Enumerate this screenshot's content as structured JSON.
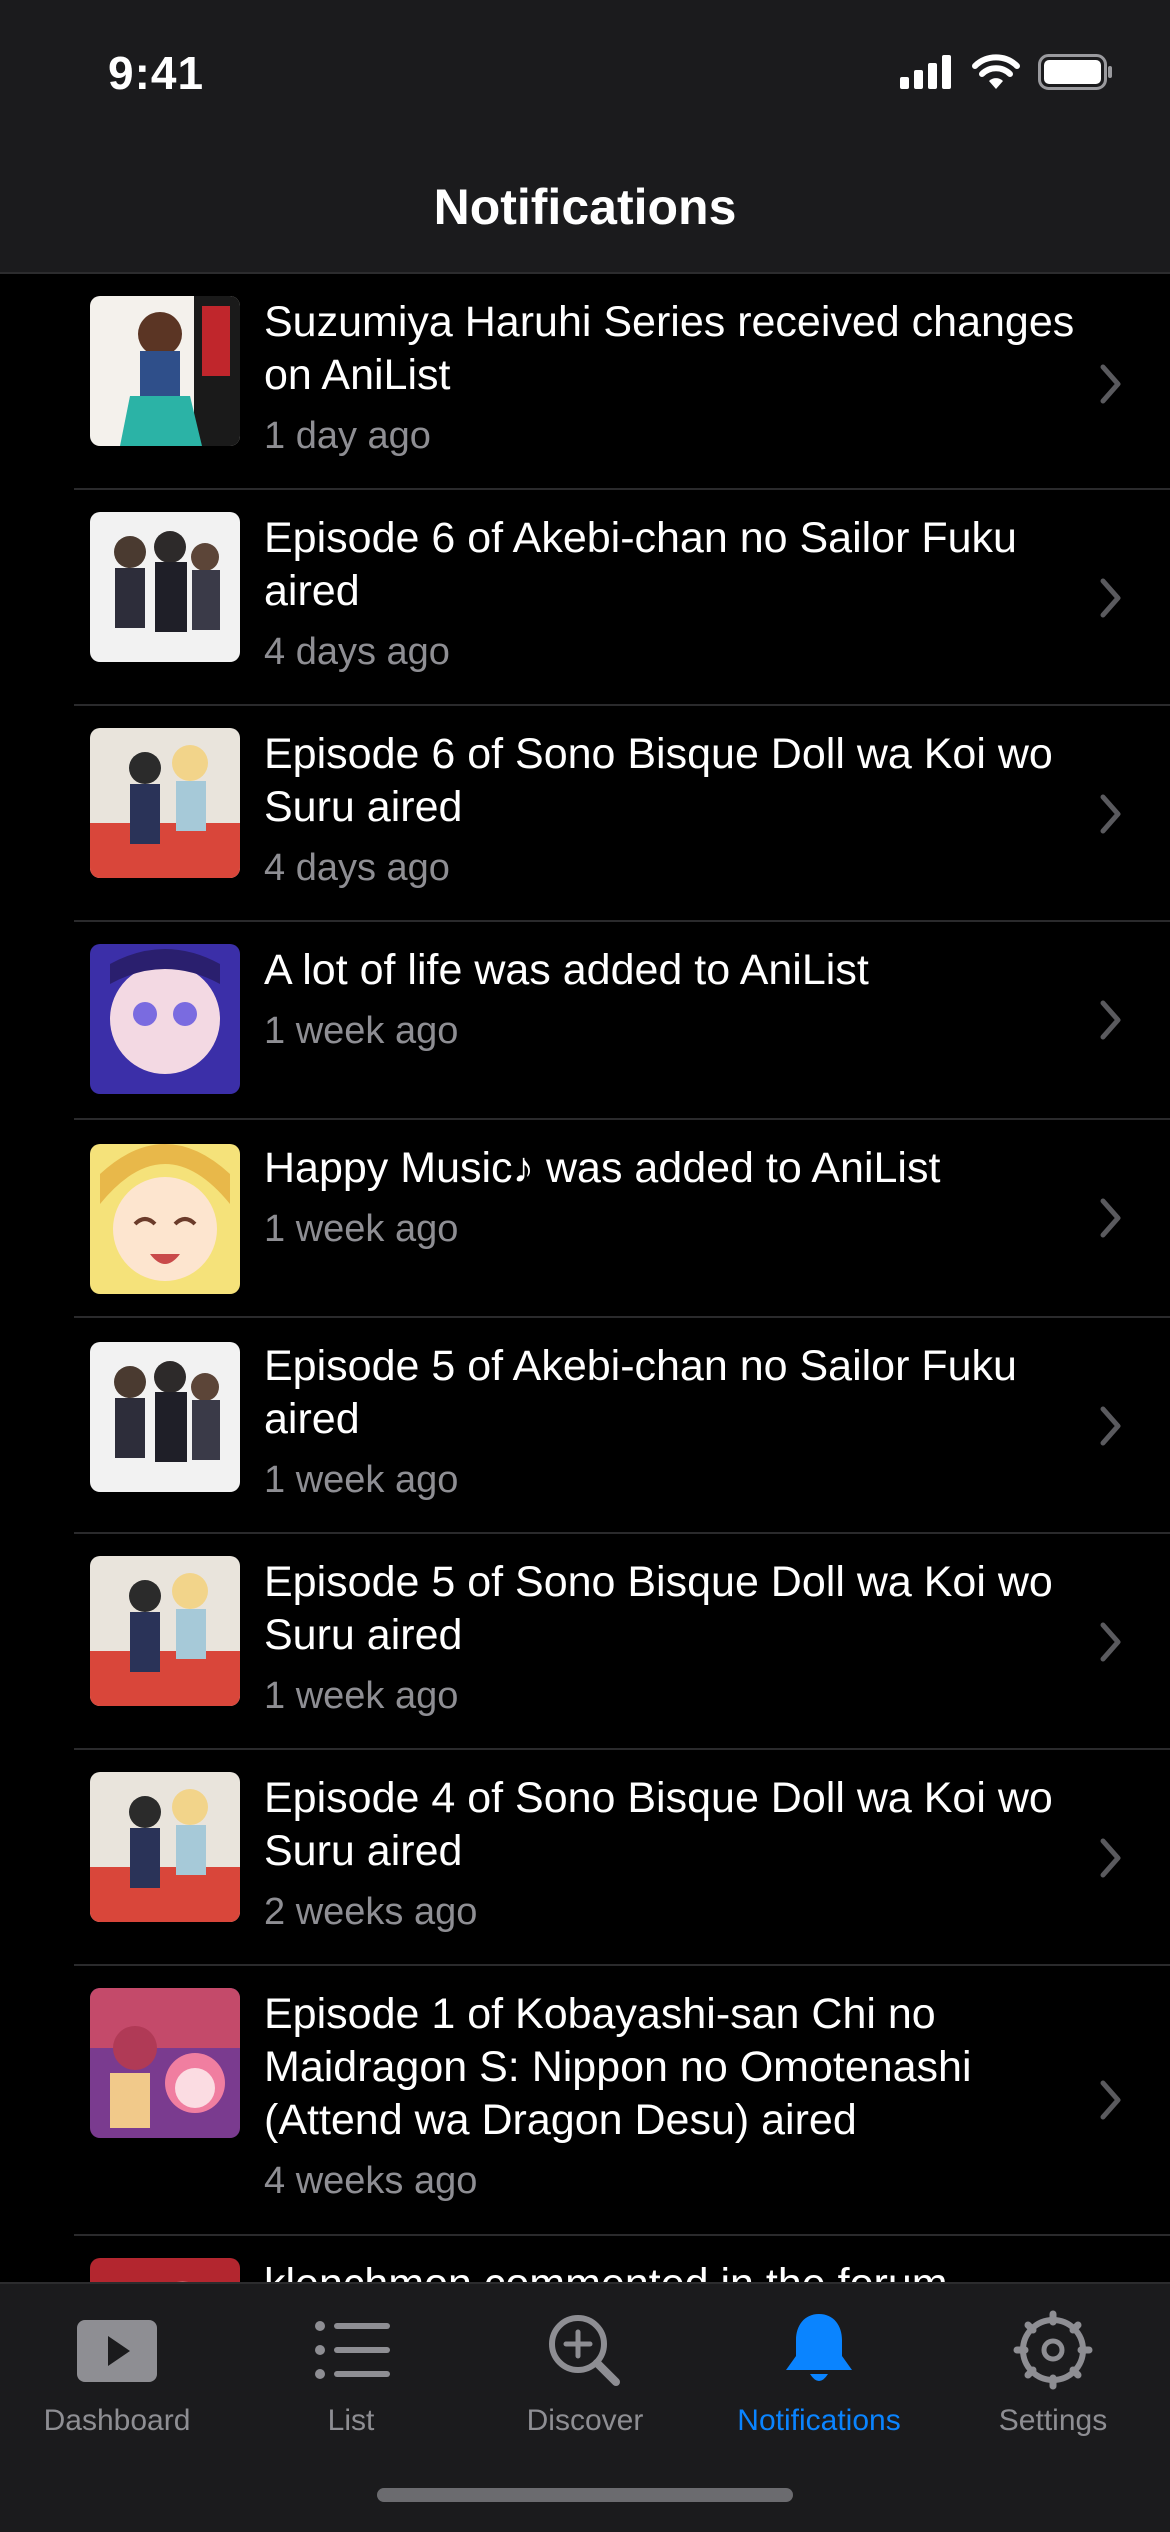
{
  "status_bar": {
    "time": "9:41"
  },
  "nav": {
    "title": "Notifications"
  },
  "notifications": [
    {
      "title": "Suzumiya Haruhi Series received changes on AniList",
      "time": "1 day ago"
    },
    {
      "title": "Episode 6 of Akebi-chan no Sailor Fuku aired",
      "time": "4 days ago"
    },
    {
      "title": "Episode 6 of Sono Bisque Doll wa Koi wo Suru aired",
      "time": "4 days ago"
    },
    {
      "title": "A lot of life was added to AniList",
      "time": "1 week ago"
    },
    {
      "title": "Happy Music♪ was added to AniList",
      "time": "1 week ago"
    },
    {
      "title": "Episode 5 of Akebi-chan no Sailor Fuku aired",
      "time": "1 week ago"
    },
    {
      "title": "Episode 5 of Sono Bisque Doll wa Koi wo Suru aired",
      "time": "1 week ago"
    },
    {
      "title": "Episode 4 of Sono Bisque Doll wa Koi wo Suru aired",
      "time": "2 weeks ago"
    },
    {
      "title": "Episode 1 of Kobayashi-san Chi no Maidragon S: Nippon no Omotenashi (Attend wa Dragon Desu) aired",
      "time": "4 weeks ago"
    },
    {
      "title": "klenchmon commented in the forum",
      "time": ""
    }
  ],
  "tabs": [
    {
      "label": "Dashboard",
      "icon": "play-rectangle-icon",
      "active": false
    },
    {
      "label": "List",
      "icon": "list-icon",
      "active": false
    },
    {
      "label": "Discover",
      "icon": "magnifier-plus-icon",
      "active": false
    },
    {
      "label": "Notifications",
      "icon": "bell-icon",
      "active": true
    },
    {
      "label": "Settings",
      "icon": "gear-icon",
      "active": false
    }
  ],
  "colors": {
    "accent": "#0a84ff",
    "secondary_text": "#8e8e93",
    "background": "#000000",
    "bar": "#1b1b1d"
  }
}
